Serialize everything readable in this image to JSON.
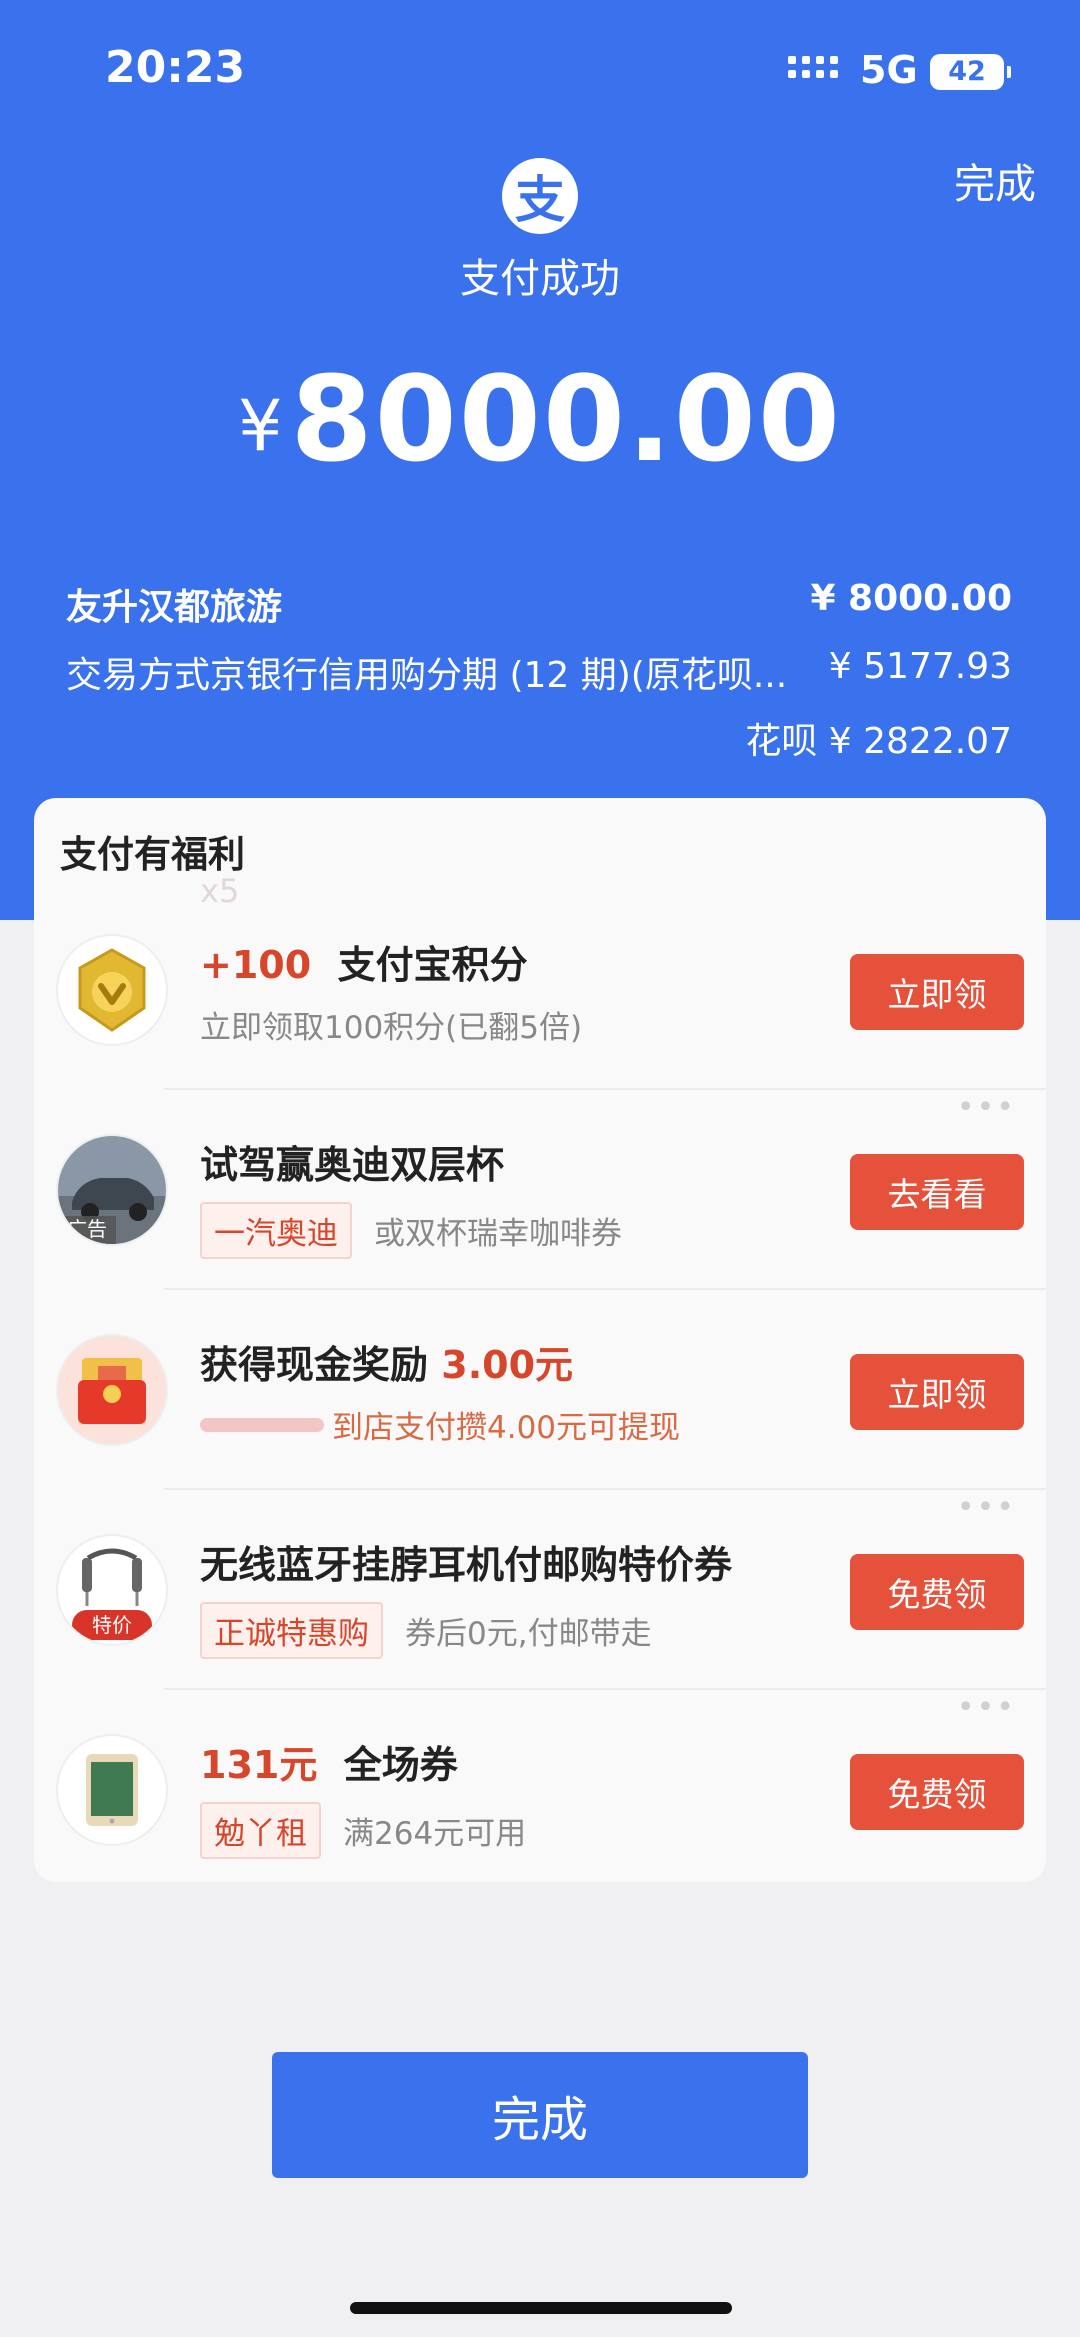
{
  "status_bar": {
    "time": "20:23",
    "network": "5G",
    "battery": "42"
  },
  "header": {
    "done_label": "完成",
    "logo_glyph": "支",
    "title": "支付成功"
  },
  "payment": {
    "currency": "¥",
    "amount": "8000.00",
    "merchant": "友升汉都旅游",
    "merchant_amount": "¥ 8000.00",
    "method": "交易方式京银行信用购分期 (12 期)(原花呗...",
    "method_amount": "¥ 5177.93",
    "huabei": "花呗 ¥ 2822.07"
  },
  "benefits": {
    "title": "支付有福利",
    "faint_mark": "x5",
    "items": [
      {
        "title_highlight": "+100",
        "title": "支付宝积分",
        "tag": "",
        "desc": "立即领取100积分(已翻5倍)",
        "button": "立即领",
        "thumb_icon": "gold-coin-icon"
      },
      {
        "title_highlight": "",
        "title": "试驾赢奥迪双层杯",
        "tag": "一汽奥迪",
        "desc": "或双杯瑞幸咖啡券",
        "button": "去看看",
        "thumb_icon": "car-image",
        "thumb_badge": "广告"
      },
      {
        "title": "获得现金奖励",
        "title_suffix": "3.00元",
        "tag": "",
        "desc": "到店支付攒4.00元可提现",
        "button": "立即领",
        "thumb_icon": "red-envelope-icon"
      },
      {
        "title_highlight": "",
        "title": "无线蓝牙挂脖耳机付邮购特价券",
        "tag": "正诚特惠购",
        "desc": "券后0元,付邮带走",
        "button": "免费领",
        "thumb_icon": "headphones-image",
        "thumb_badge": "特价"
      },
      {
        "title_highlight": "131元",
        "title": "全场券",
        "tag": "勉丫租",
        "desc": "满264元可用",
        "button": "免费领",
        "thumb_icon": "tablet-image"
      }
    ]
  },
  "footer": {
    "done_button": "完成"
  },
  "colors": {
    "brand_blue": "#3a72ee",
    "cta_red": "#e5513a",
    "accent_red": "#d7452a"
  }
}
